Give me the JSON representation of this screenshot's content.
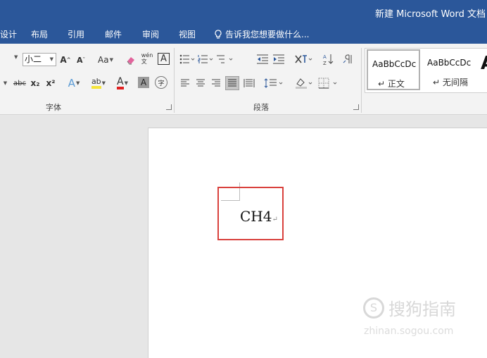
{
  "title": "新建 Microsoft Word 文档",
  "tabs": [
    "设计",
    "布局",
    "引用",
    "邮件",
    "审阅",
    "视图"
  ],
  "tell_me": "告诉我您想要做什么...",
  "font_size": "小二",
  "font_group": {
    "label": "字体",
    "grow_label": "A",
    "shrink_label": "A",
    "case_label": "Aa",
    "phonetic_label": "wén\n文",
    "border_char_label": "A",
    "strike_label": "abc",
    "sub_label": "x₂",
    "sup_label": "x²",
    "effects_label": "A",
    "highlight_label": "ab",
    "color_label": "A",
    "shade_label": "A",
    "enclose_label": "字"
  },
  "paragraph_group": {
    "label": "段落"
  },
  "styles": [
    {
      "sample": "AaBbCcDc",
      "name": "↵ 正文"
    },
    {
      "sample": "AaBbCcDc",
      "name": "↵ 无间隔"
    }
  ],
  "style_big_sample": "A",
  "document": {
    "text": "CH4",
    "mark": "↵"
  },
  "watermark": {
    "line1": "搜狗指南",
    "line2": "zhinan.sogou.com"
  },
  "colors": {
    "brand": "#2b579a",
    "highlight_box": "#d9413d",
    "font_color": "#e02020",
    "highlight_color": "#f5e43a"
  }
}
